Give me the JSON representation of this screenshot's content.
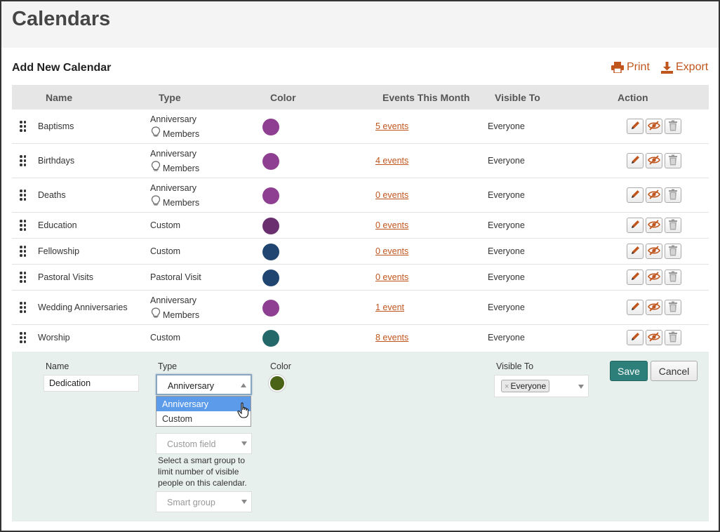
{
  "page": {
    "title": "Calendars"
  },
  "section": {
    "title": "Add New Calendar"
  },
  "toolbar": {
    "print_label": "Print",
    "export_label": "Export"
  },
  "table": {
    "headers": {
      "name": "Name",
      "type": "Type",
      "color": "Color",
      "events": "Events This Month",
      "visible": "Visible To",
      "action": "Action"
    },
    "rows": [
      {
        "name": "Baptisms",
        "type": "Anniversary",
        "type_sub": "Members",
        "color": "#8e3f91",
        "events": "5 events",
        "visible": "Everyone"
      },
      {
        "name": "Birthdays",
        "type": "Anniversary",
        "type_sub": "Members",
        "color": "#8e3f91",
        "events": "4 events",
        "visible": "Everyone"
      },
      {
        "name": "Deaths",
        "type": "Anniversary",
        "type_sub": "Members",
        "color": "#8e3f91",
        "events": "0 events",
        "visible": "Everyone"
      },
      {
        "name": "Education",
        "type": "Custom",
        "type_sub": "",
        "color": "#6a2f6f",
        "events": "0 events",
        "visible": "Everyone"
      },
      {
        "name": "Fellowship",
        "type": "Custom",
        "type_sub": "",
        "color": "#1f4570",
        "events": "0 events",
        "visible": "Everyone"
      },
      {
        "name": "Pastoral Visits",
        "type": "Pastoral Visit",
        "type_sub": "",
        "color": "#1f4570",
        "events": "0 events",
        "visible": "Everyone"
      },
      {
        "name": "Wedding Anniversaries",
        "type": "Anniversary",
        "type_sub": "Members",
        "color": "#8e3f91",
        "events": "1 event",
        "visible": "Everyone"
      },
      {
        "name": "Worship",
        "type": "Custom",
        "type_sub": "",
        "color": "#25686a",
        "events": "8 events",
        "visible": "Everyone"
      }
    ]
  },
  "edit_form": {
    "name_label": "Name",
    "name_value": "Dedication",
    "type_label": "Type",
    "type_value": "Anniversary",
    "type_options": [
      "Anniversary",
      "Custom"
    ],
    "color_label": "Color",
    "color_value": "#4a6316",
    "custom_field_placeholder": "Custom field",
    "help_text": "Select a smart group to limit number of visible people on this calendar.",
    "smart_group_placeholder": "Smart group",
    "visible_label": "Visible To",
    "visible_tag": "Everyone",
    "save_label": "Save",
    "cancel_label": "Cancel"
  },
  "colors": {
    "accent": "#c0561e",
    "save": "#2d7f7a",
    "dropdown_selected": "#5b9bea"
  }
}
